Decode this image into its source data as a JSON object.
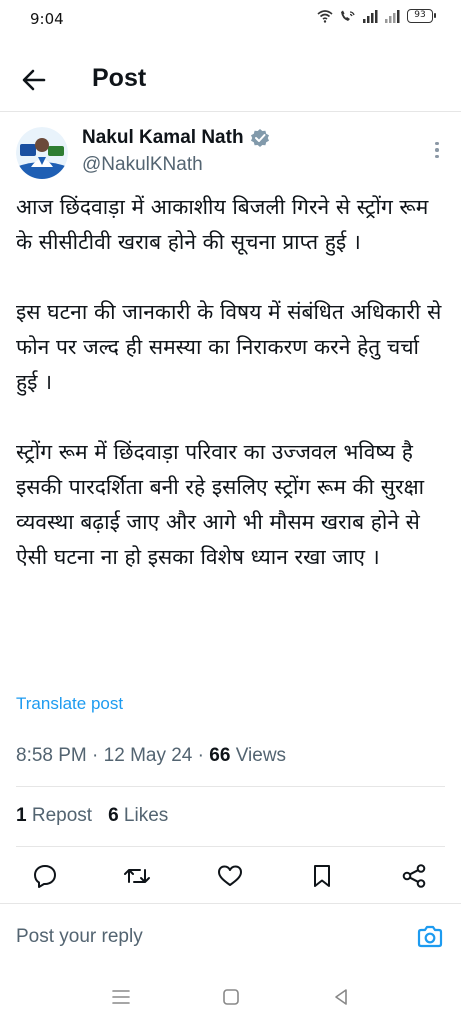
{
  "status_bar": {
    "time": "9:04",
    "battery": "93"
  },
  "header": {
    "back_icon": "arrow-left-icon",
    "title": "Post"
  },
  "author": {
    "name": "Nakul Kamal Nath",
    "handle": "@NakulKNath",
    "verified_badge_color": "#829aab"
  },
  "tweet": {
    "paragraphs": [
      "आज छिंदवाड़ा में आकाशीय बिजली गिरने से स्ट्रोंग रूम के सीसीटीवी खराब होने की सूचना प्राप्त हुई ।",
      "इस घटना की जानकारी के विषय में संबंधित अधिकारी से फोन पर जल्द ही समस्या का निराकरण करने हेतु चर्चा हुई ।",
      "स्ट्रोंग रूम में छिंदवाड़ा परिवार का उज्जवल भविष्य है इसकी पारदर्शिता बनी रहे इसलिए स्ट्रोंग रूम की सुरक्षा व्यवस्था बढ़ाई जाए और आगे भी मौसम खराब होने से ऐसी घटना ना हो इसका विशेष ध्यान रखा जाए ।"
    ],
    "translate_label": "Translate post"
  },
  "meta": {
    "time": "8:58 PM",
    "sep1": " · ",
    "date": "12 May 24",
    "sep2": " · ",
    "views_count": "66",
    "views_label": " Views"
  },
  "stats": {
    "reposts_count": "1",
    "reposts_label": " Repost",
    "likes_count": "6",
    "likes_label": " Likes"
  },
  "actions": [
    "reply-icon",
    "repost-icon",
    "like-icon",
    "bookmark-icon",
    "share-icon"
  ],
  "reply": {
    "placeholder": "Post your reply",
    "camera_icon": "camera-icon"
  },
  "colors": {
    "link": "#1d9bf0",
    "secondary_text": "#536471",
    "primary_text": "#0f1419"
  }
}
